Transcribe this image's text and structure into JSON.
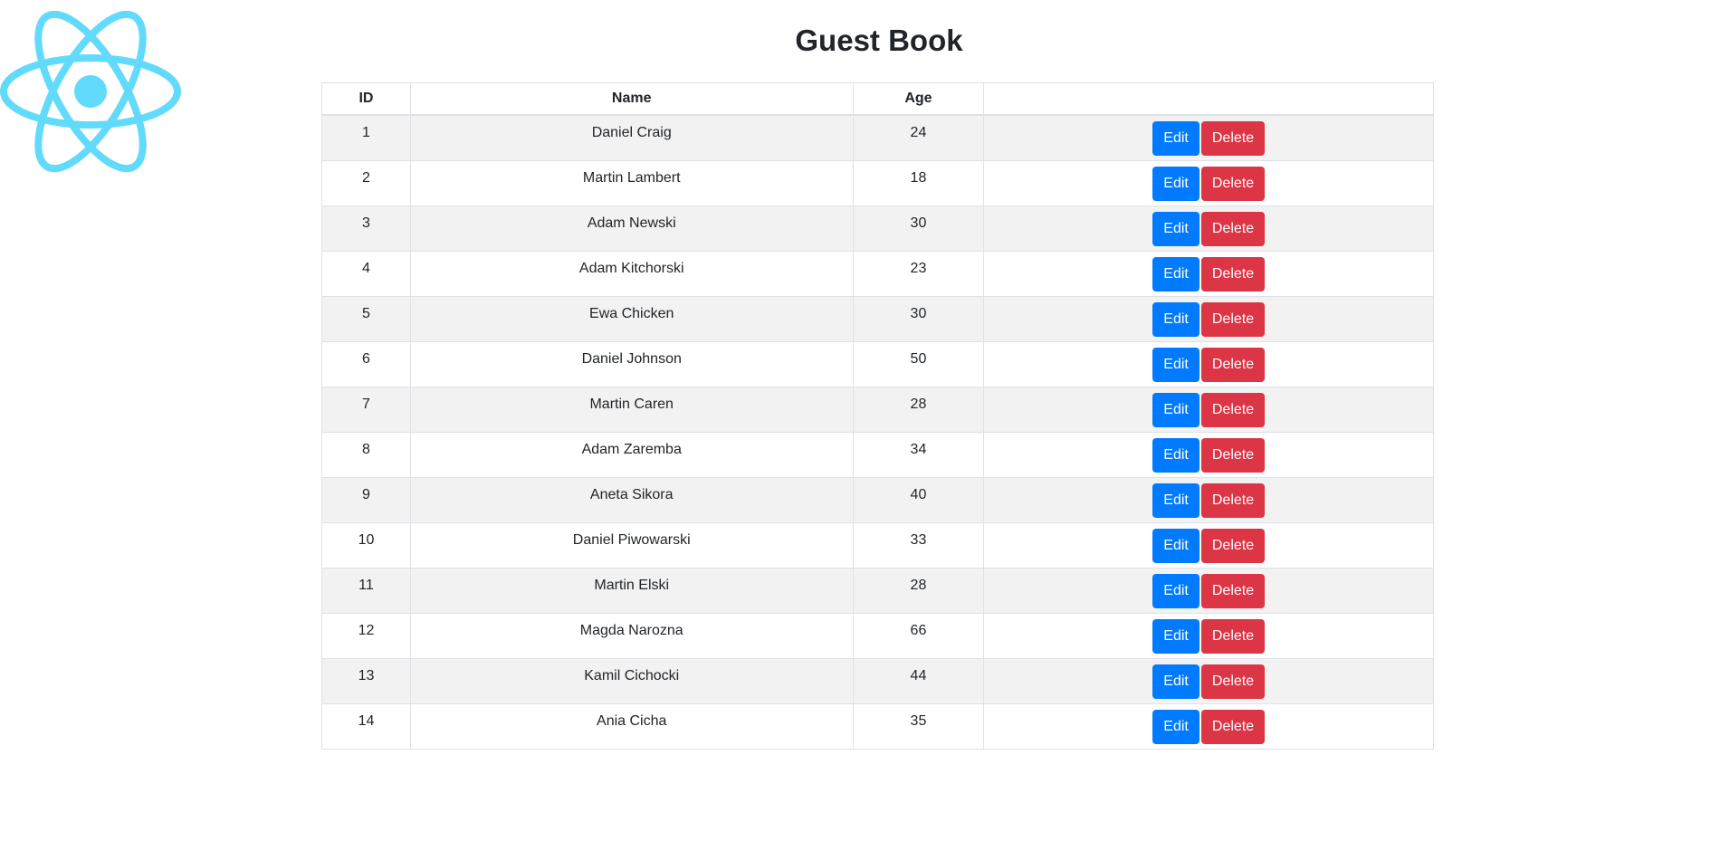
{
  "page": {
    "title": "Guest Book"
  },
  "logo": {
    "icon": "react-atom-icon",
    "color": "#61dafb"
  },
  "table": {
    "headers": {
      "id": "ID",
      "name": "Name",
      "age": "Age",
      "actions": ""
    },
    "rows": [
      {
        "id": "1",
        "name": "Daniel Craig",
        "age": "24"
      },
      {
        "id": "2",
        "name": "Martin Lambert",
        "age": "18"
      },
      {
        "id": "3",
        "name": "Adam Newski",
        "age": "30"
      },
      {
        "id": "4",
        "name": "Adam Kitchorski",
        "age": "23"
      },
      {
        "id": "5",
        "name": "Ewa Chicken",
        "age": "30"
      },
      {
        "id": "6",
        "name": "Daniel Johnson",
        "age": "50"
      },
      {
        "id": "7",
        "name": "Martin Caren",
        "age": "28"
      },
      {
        "id": "8",
        "name": "Adam Zaremba",
        "age": "34"
      },
      {
        "id": "9",
        "name": "Aneta Sikora",
        "age": "40"
      },
      {
        "id": "10",
        "name": "Daniel Piwowarski",
        "age": "33"
      },
      {
        "id": "11",
        "name": "Martin Elski",
        "age": "28"
      },
      {
        "id": "12",
        "name": "Magda Narozna",
        "age": "66"
      },
      {
        "id": "13",
        "name": "Kamil Cichocki",
        "age": "44"
      },
      {
        "id": "14",
        "name": "Ania Cicha",
        "age": "35"
      }
    ],
    "edit_label": "Edit",
    "delete_label": "Delete"
  },
  "colors": {
    "edit_button": "#007bff",
    "delete_button": "#dc3545",
    "striped_row": "#f2f2f2",
    "border": "#dee2e6"
  }
}
